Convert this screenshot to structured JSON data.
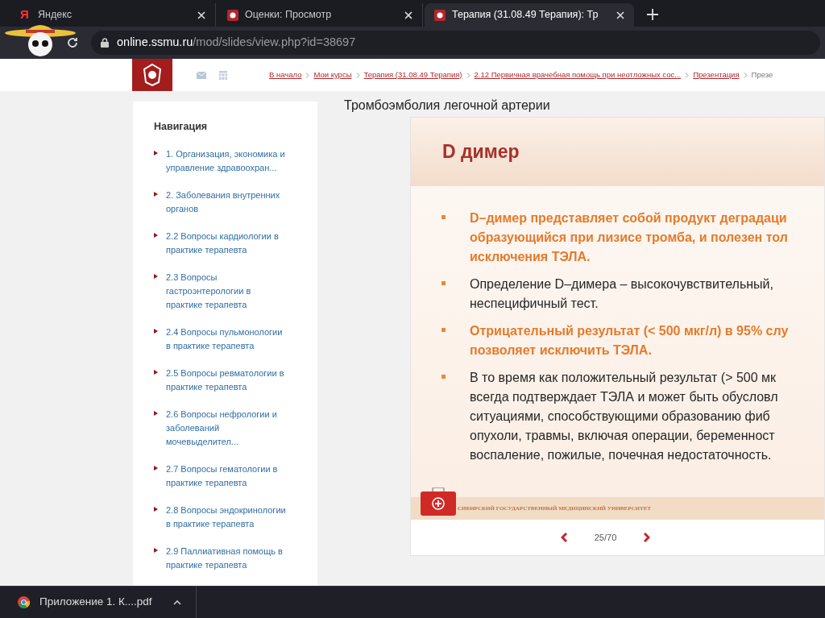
{
  "tabs": [
    {
      "title": "Яндекс",
      "selected": false,
      "kind": "yandex",
      "icon": "Я"
    },
    {
      "title": "Оценки: Просмотр",
      "selected": false,
      "kind": "crest"
    },
    {
      "title": "Терапия (31.08.49 Терапия): Тр",
      "selected": true,
      "kind": "crest"
    }
  ],
  "address_bar": {
    "host": "online.ssmu.ru",
    "path": "/mod/slides/view.php?id=38697"
  },
  "breadcrumbs": [
    {
      "label": "В начало",
      "link": true
    },
    {
      "label": "Мои курсы",
      "link": true
    },
    {
      "label": "Терапия (31.08.49 Терапия)",
      "link": true
    },
    {
      "label": "2.12 Первичная врачебная помощь при неотложных сос...",
      "link": true
    },
    {
      "label": "Презентация",
      "link": true
    },
    {
      "label": "Презе",
      "link": false
    }
  ],
  "sidebar": {
    "title": "Навигация",
    "items": [
      {
        "label": "1. Организация, экономика и управление здравоохран..."
      },
      {
        "label": "2. Заболевания внутренних органов"
      },
      {
        "label": "2.2 Вопросы кардиологии в практике терапевта"
      },
      {
        "label": "2.3 Вопросы гастроэнтерологии в практике терапевта"
      },
      {
        "label": "2.4 Вопросы пульмонологии в практике терапевта"
      },
      {
        "label": "2.5 Вопросы ревматологии в практике терапевта"
      },
      {
        "label": "2.6 Вопросы нефрологии и заболеваний мочевыделител..."
      },
      {
        "label": "2.7 Вопросы гематологии в практике терапевта"
      },
      {
        "label": "2.8 Вопросы эндокринологии в практике терапевта"
      },
      {
        "label": "2.9 Паллиативная помощь в практике терапевта"
      }
    ]
  },
  "page_title": "Тромбоэмболия легочной артерии",
  "slide": {
    "title": "D димер",
    "bullets": [
      {
        "emphasized": true,
        "lines": [
          "D–димер представляет собой продукт деградаци",
          "образующийся при лизисе тромба, и полезен тол",
          "исключения ТЭЛА."
        ]
      },
      {
        "emphasized": false,
        "lines": [
          "Определение D–димера – высокочувствительный,",
          "неспецифичный тест."
        ]
      },
      {
        "emphasized": true,
        "lines": [
          "Отрицательный результат (< 500 мкг/л) в 95% слу",
          "позволяет исключить ТЭЛА."
        ]
      },
      {
        "emphasized": false,
        "lines": [
          "В то время как положительный результат (> 500 мк",
          "всегда подтверждает ТЭЛА и может быть обусловл",
          "ситуациями, способствующими образованию фиб",
          "опухоли, травмы, включая операции, беременност",
          "воспаление, пожилые, почечная недостаточность."
        ]
      }
    ],
    "footer": "СИБИРСКИЙ ГОСУДАРСТВЕННЫЙ МЕДИЦИНСКИЙ УНИВЕРСИТЕТ",
    "counter": "25/70"
  },
  "download_bar": {
    "file": "Приложение 1. К....pdf"
  }
}
